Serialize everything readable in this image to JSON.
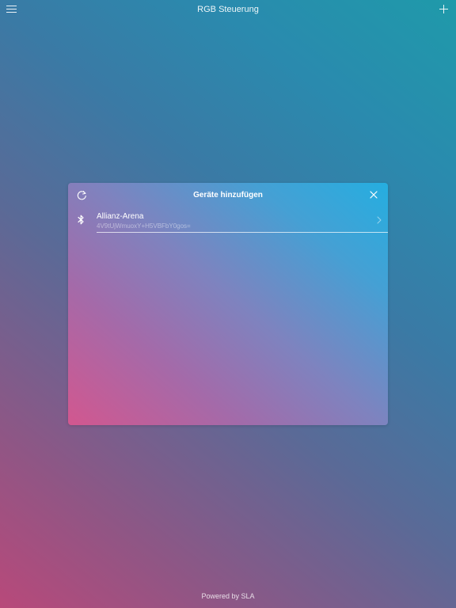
{
  "header": {
    "title": "RGB Steuerung",
    "menu_icon": "hamburger-menu-icon",
    "add_icon": "plus-icon"
  },
  "dialog": {
    "title": "Geräte hinzufügen",
    "refresh_icon": "refresh-icon",
    "close_icon": "close-icon",
    "devices": [
      {
        "name": "Allianz-Arena",
        "id": "4V9tUjWmuoxY+H5VBFbY0gos=",
        "icon": "bluetooth-icon",
        "chevron_icon": "chevron-right-icon"
      }
    ]
  },
  "footer": {
    "text": "Powered by SLA"
  },
  "colors": {
    "background_start": "#b8497a",
    "background_end": "#1f9aaa",
    "dialog_start": "#d2578f",
    "dialog_end": "#25aee0",
    "text": "#ffffff"
  }
}
